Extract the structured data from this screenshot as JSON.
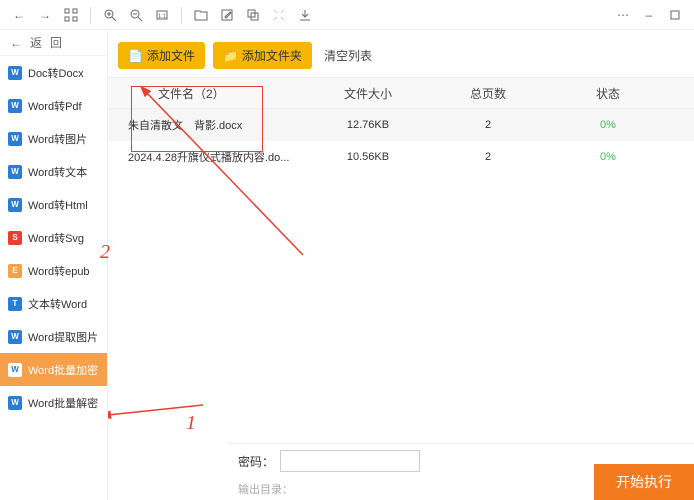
{
  "toolbar": {
    "icons": [
      "←",
      "→",
      "▦",
      "|",
      "⊕",
      "⊖",
      "⧉",
      "|",
      "📄",
      "✎",
      "⧉",
      "⤢",
      "⬇"
    ],
    "right_icons": [
      "⋯",
      "–",
      "☐"
    ]
  },
  "sidebar": {
    "back_label": "返",
    "refresh_label": "回",
    "items": [
      {
        "icon": "W",
        "color": "#2b7cd3",
        "label": "Doc转Docx"
      },
      {
        "icon": "W",
        "color": "#2b7cd3",
        "label": "Word转Pdf"
      },
      {
        "icon": "W",
        "color": "#2b7cd3",
        "label": "Word转图片"
      },
      {
        "icon": "W",
        "color": "#2b7cd3",
        "label": "Word转文本"
      },
      {
        "icon": "W",
        "color": "#2b7cd3",
        "label": "Word转Html"
      },
      {
        "icon": "S",
        "color": "#e74032",
        "label": "Word转Svg"
      },
      {
        "icon": "E",
        "color": "#f7a04b",
        "label": "Word转epub"
      },
      {
        "icon": "T",
        "color": "#2b7cd3",
        "label": "文本转Word"
      },
      {
        "icon": "W",
        "color": "#2b7cd3",
        "label": "Word提取图片"
      },
      {
        "icon": "W",
        "color": "#2b7cd3",
        "label": "Word批量加密",
        "active": true
      },
      {
        "icon": "W",
        "color": "#2b7cd3",
        "label": "Word批量解密"
      }
    ]
  },
  "actions": {
    "add_file": "添加文件",
    "add_folder": "添加文件夹",
    "clear_list": "清空列表"
  },
  "table": {
    "header": {
      "name": "文件名（2）",
      "size": "文件大小",
      "pages": "总页数",
      "status": "状态"
    },
    "rows": [
      {
        "name": "朱自清散文　背影.docx",
        "size": "12.76KB",
        "pages": "2",
        "status": "0%"
      },
      {
        "name": "2024.4.28升旗仪式播放内容.do...",
        "size": "10.56KB",
        "pages": "2",
        "status": "0%"
      }
    ]
  },
  "footer": {
    "pwd_label": "密码：",
    "output_label": "输出目录："
  },
  "run_button": "开始执行",
  "annotations": {
    "num1": "1",
    "num2": "2"
  }
}
